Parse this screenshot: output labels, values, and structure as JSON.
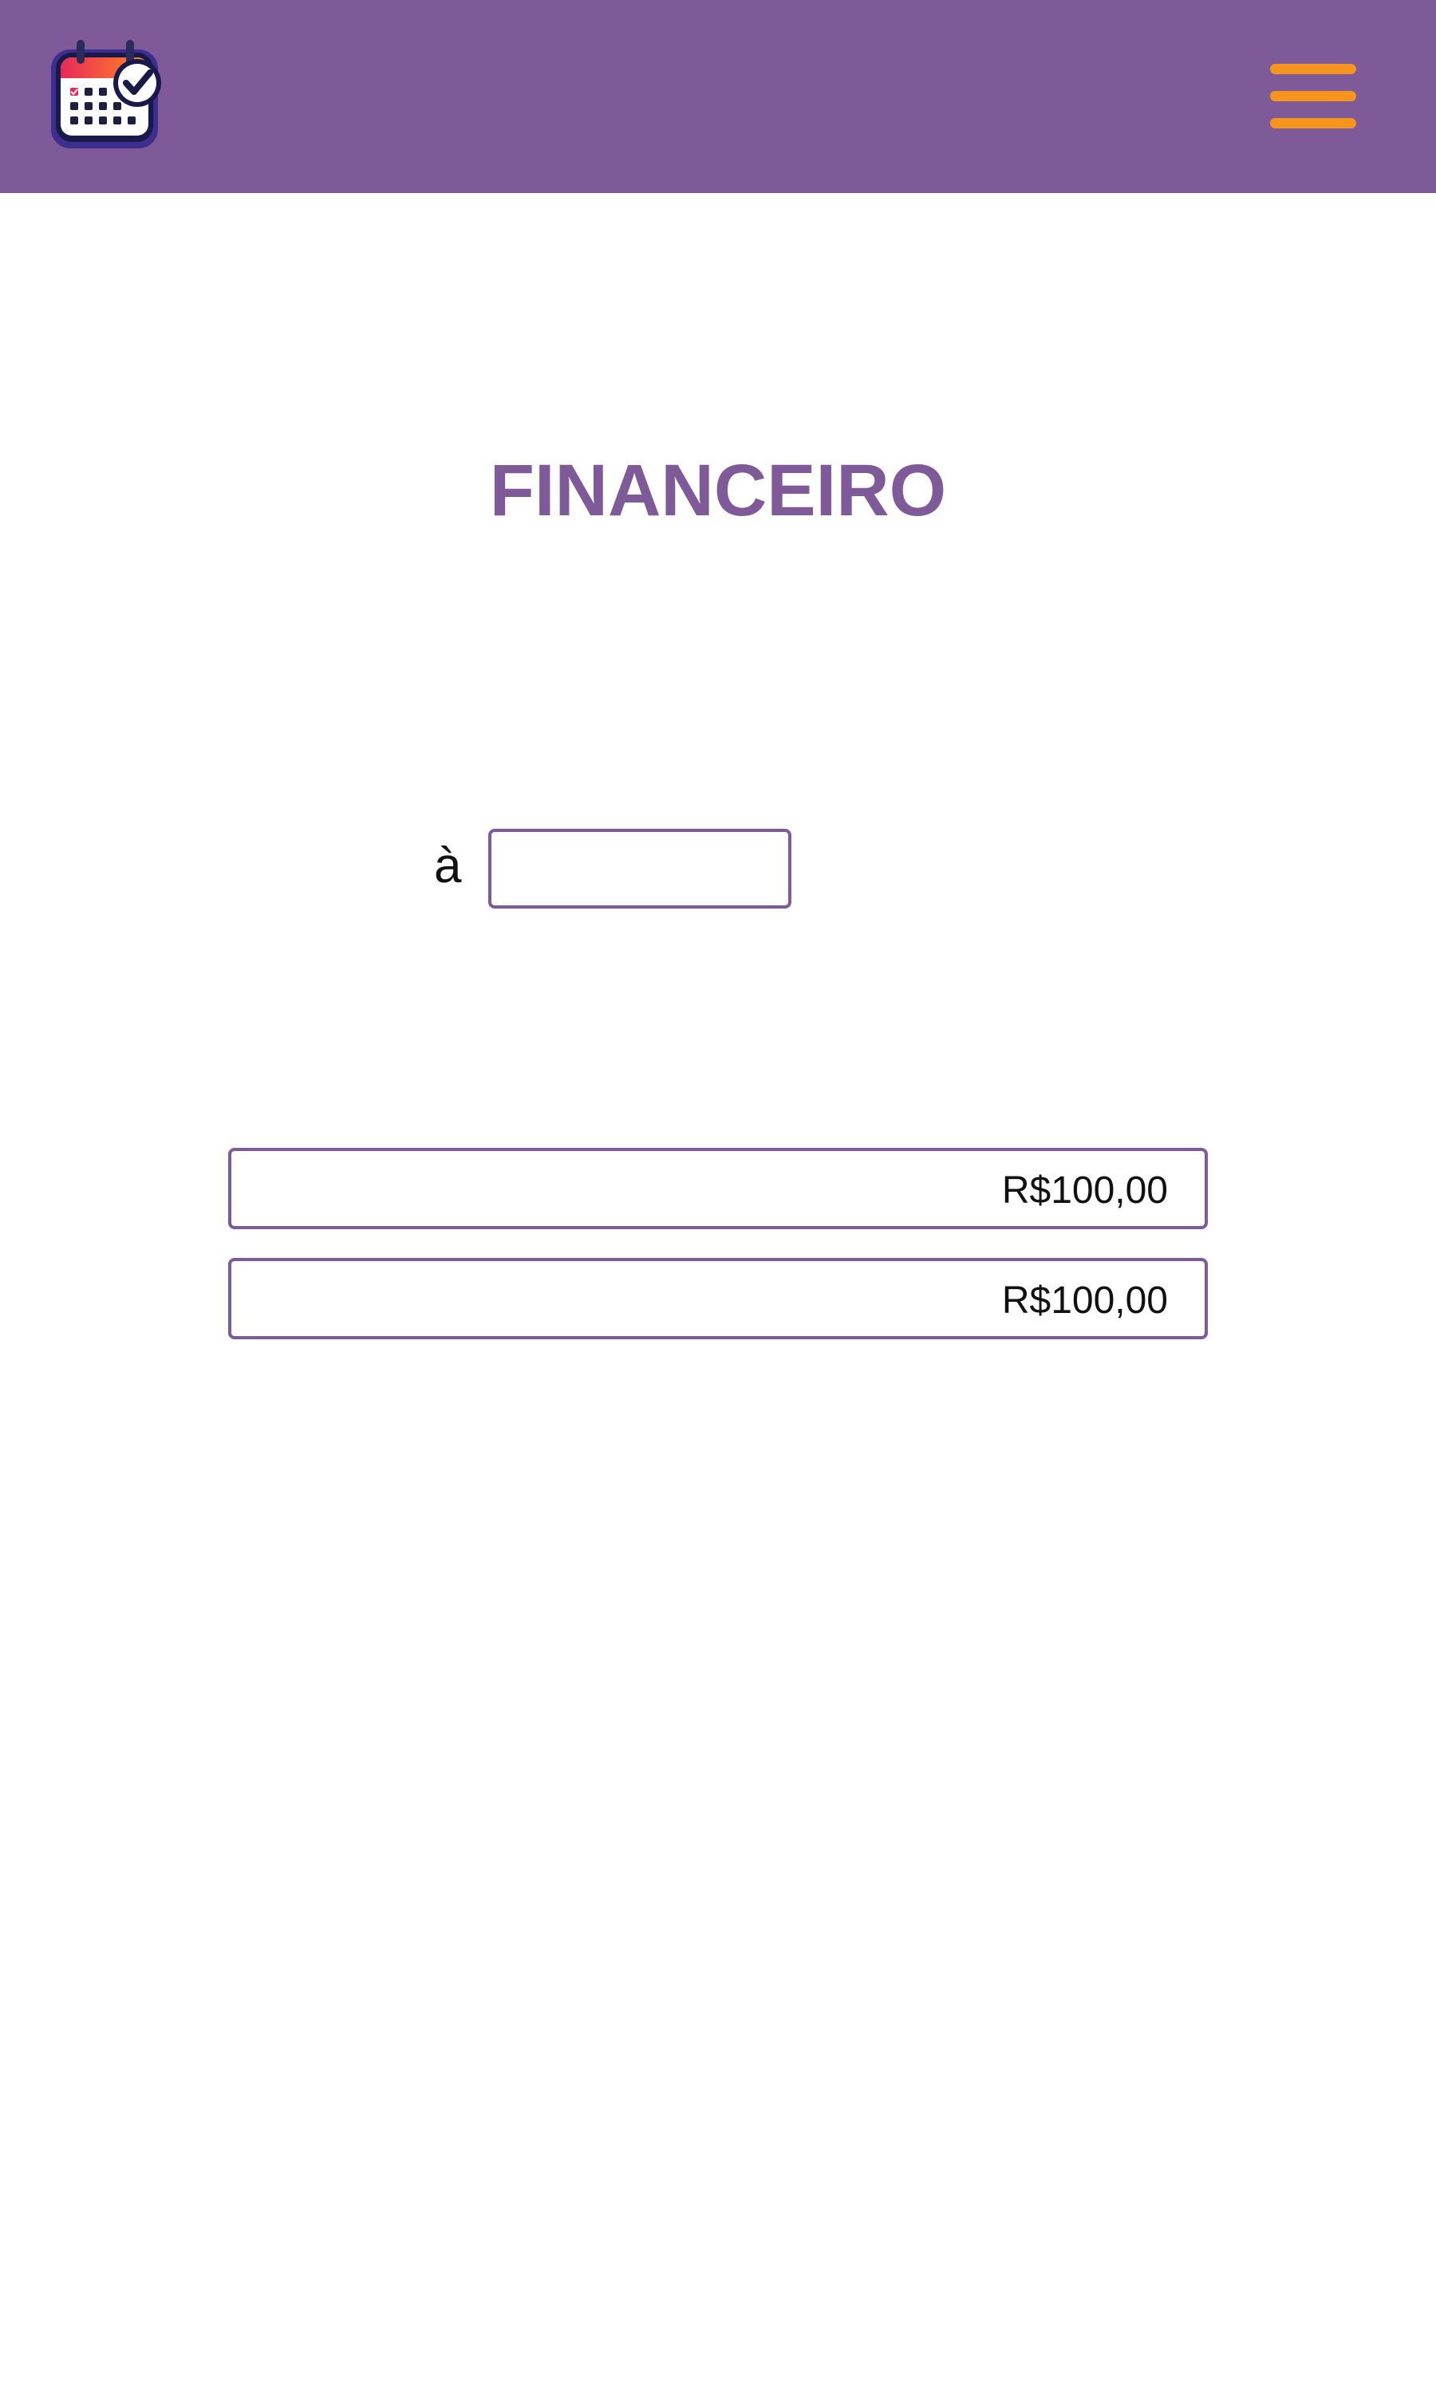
{
  "header": {
    "logo_icon": "calendar-check-icon",
    "menu_icon": "hamburger-menu-icon",
    "background_color": "#7f5a98",
    "menu_color": "#f7941d"
  },
  "main": {
    "title": "FINANCEIRO",
    "filter": {
      "separator_label": "à",
      "end_value": ""
    },
    "values": [
      {
        "amount": "R$100,00"
      },
      {
        "amount": "R$100,00"
      }
    ]
  }
}
